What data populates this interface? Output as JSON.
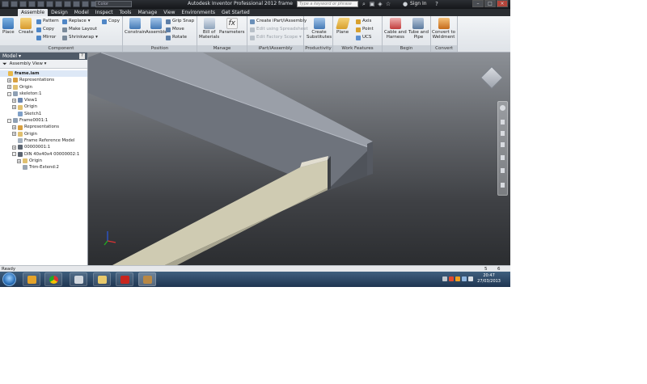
{
  "titlebar": {
    "app_title": "Autodesk Inventor Professional 2012   frame",
    "color_box": "Color",
    "search_placeholder": "Type a keyword or phrase",
    "signin": "Sign In"
  },
  "tabs": [
    "Assemble",
    "Design",
    "Model",
    "Inspect",
    "Tools",
    "Manage",
    "View",
    "Environments",
    "Get Started"
  ],
  "active_tab": "Assemble",
  "ribbon": {
    "component": {
      "title": "Component",
      "place": "Place",
      "create": "Create",
      "pattern": "Pattern",
      "copy": "Copy",
      "mirror": "Mirror",
      "replace": "Replace",
      "make_layout": "Make Layout",
      "shrinkwrap": "Shrinkwrap",
      "copy2": "Copy"
    },
    "position": {
      "title": "Position",
      "constrain": "Constrain",
      "assemble": "Assemble",
      "grip_snap": "Grip Snap",
      "move": "Move",
      "rotate": "Rotate"
    },
    "manage": {
      "title": "Manage",
      "bom_1": "Bill of",
      "bom_2": "Materials",
      "parameters": "Parameters"
    },
    "ipart": {
      "title": "iPart/iAssembly",
      "create": "Create iPart/iAssembly",
      "edit_spreadsheet": "Edit using Spreadsheet",
      "edit_factory": "Edit Factory Scope"
    },
    "productivity": {
      "title": "Productivity",
      "create_sub_1": "Create",
      "create_sub_2": "Substitutes"
    },
    "work_features": {
      "title": "Work Features",
      "plane": "Plane",
      "axis": "Axis",
      "point": "Point",
      "ucs": "UCS"
    },
    "begin": {
      "title": "Begin",
      "cable_1": "Cable and",
      "cable_2": "Harness",
      "tube_1": "Tube and",
      "tube_2": "Pipe"
    },
    "convert": {
      "title": "Convert",
      "conv_1": "Convert to",
      "conv_2": "Weldment"
    }
  },
  "browser": {
    "title": "Model",
    "help": "?",
    "view_label": "Assembly View",
    "tree": [
      {
        "label": "frame.iam",
        "indent": 0,
        "toggle": ""
      },
      {
        "label": "Representations",
        "indent": 1,
        "toggle": "+"
      },
      {
        "label": "Origin",
        "indent": 1,
        "toggle": "+"
      },
      {
        "label": "skeleton:1",
        "indent": 1,
        "toggle": "-"
      },
      {
        "label": "View1",
        "indent": 2,
        "toggle": "+"
      },
      {
        "label": "Origin",
        "indent": 2,
        "toggle": "+"
      },
      {
        "label": "Sketch1",
        "indent": 2,
        "toggle": ""
      },
      {
        "label": "Frame0001:1",
        "indent": 1,
        "toggle": "-"
      },
      {
        "label": "Representations",
        "indent": 2,
        "toggle": "+"
      },
      {
        "label": "Origin",
        "indent": 2,
        "toggle": "+"
      },
      {
        "label": "Frame Reference Model",
        "indent": 2,
        "toggle": ""
      },
      {
        "label": "00000001:1",
        "indent": 2,
        "toggle": "+"
      },
      {
        "label": "DIN 40x40x4 00000002:1",
        "indent": 2,
        "toggle": "-"
      },
      {
        "label": "Origin",
        "indent": 3,
        "toggle": "+"
      },
      {
        "label": "Trim-Extend:2",
        "indent": 3,
        "toggle": ""
      }
    ]
  },
  "status": {
    "left": "Ready",
    "n1": "5",
    "n2": "6"
  },
  "clock": {
    "time": "20:47",
    "date": "27/03/2013"
  },
  "colors": {
    "ribbon_bg": "#e4e7eb",
    "viewport_top": "#8c9096",
    "viewport_bottom": "#2b2d30",
    "channel_gray": "#6e737c",
    "beam_tan": "#cfcbb2"
  }
}
